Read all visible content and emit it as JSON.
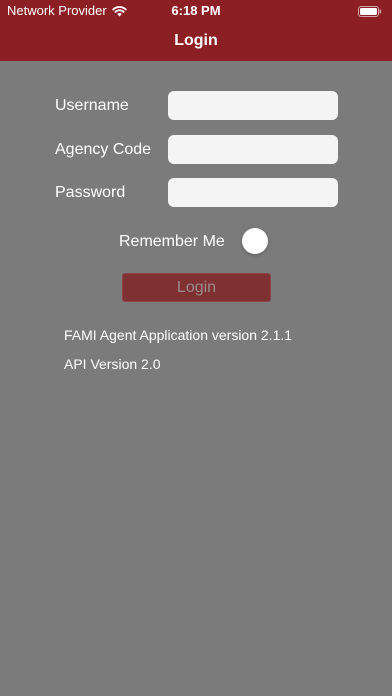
{
  "status_bar": {
    "carrier": "Network Provider",
    "time": "6:18 PM",
    "wifi_icon": "wifi-icon",
    "battery_icon": "battery-full-icon"
  },
  "nav": {
    "title": "Login"
  },
  "form": {
    "username_label": "Username",
    "username_value": "",
    "agency_code_label": "Agency Code",
    "agency_code_value": "",
    "password_label": "Password",
    "password_value": "",
    "remember_me_label": "Remember Me",
    "remember_me_on": false
  },
  "login_button": {
    "label": "Login",
    "enabled": false
  },
  "footer": {
    "app_version": "FAMI Agent Application version 2.1.1",
    "api_version": "API Version 2.0"
  },
  "colors": {
    "header_background": "#8c1f23",
    "page_background": "#7b7b7b",
    "login_button_background": "#7f3033"
  }
}
